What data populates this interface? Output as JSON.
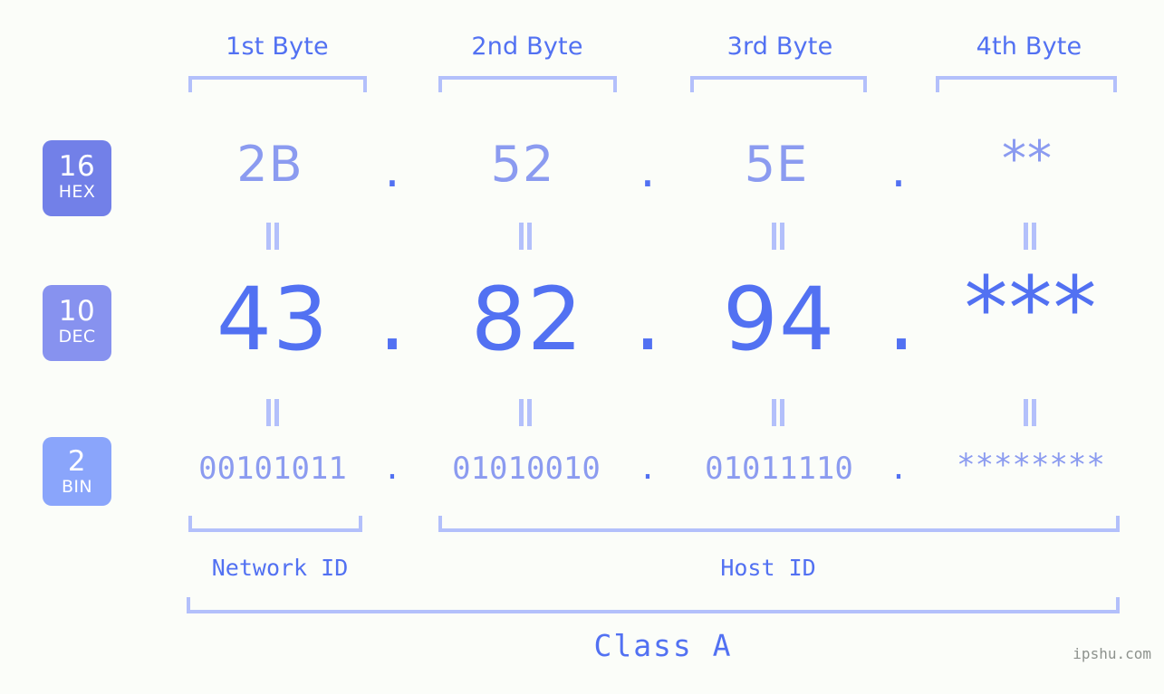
{
  "background_color": "#fbfdf9",
  "colors": {
    "accent_strong": "#5271f2",
    "accent_mid": "#8b9bf0",
    "accent_light": "#b3c0fb",
    "badge_hex": "#7280e8",
    "badge_dec": "#8792ef",
    "badge_bin": "#8aa5fb",
    "watermark": "#8d928d"
  },
  "byte_headers": [
    {
      "label": "1st Byte"
    },
    {
      "label": "2nd Byte"
    },
    {
      "label": "3rd Byte"
    },
    {
      "label": "4th Byte"
    }
  ],
  "radix_badges": [
    {
      "base": "16",
      "name": "HEX"
    },
    {
      "base": "10",
      "name": "DEC"
    },
    {
      "base": "2",
      "name": "BIN"
    }
  ],
  "rows": {
    "hex": {
      "base": "16",
      "name": "HEX",
      "values": [
        "2B",
        "52",
        "5E",
        "**"
      ],
      "separator": "."
    },
    "dec": {
      "base": "10",
      "name": "DEC",
      "values": [
        "43",
        "82",
        "94",
        "***"
      ],
      "separator": "."
    },
    "bin": {
      "base": "2",
      "name": "BIN",
      "values": [
        "00101011",
        "01010010",
        "01011110",
        "********"
      ],
      "separator": "."
    }
  },
  "equals_marker": "=",
  "segments": {
    "network_id": "Network ID",
    "host_id": "Host ID"
  },
  "class_label": "Class A",
  "watermark": "ipshu.com"
}
